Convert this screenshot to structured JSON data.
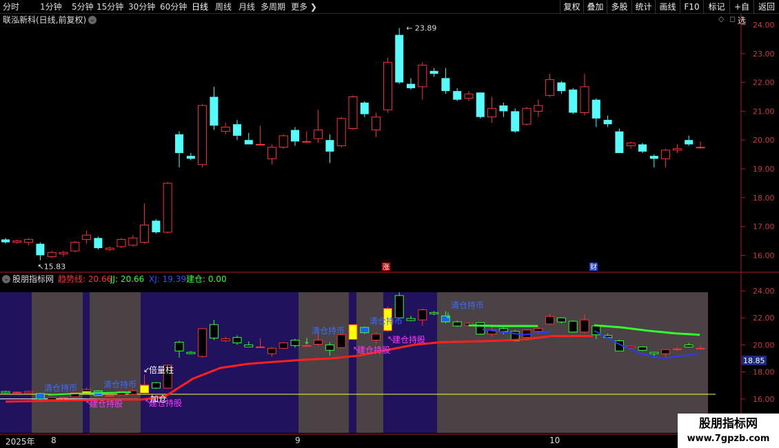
{
  "toolbar": {
    "periods": [
      "分时",
      "1分钟",
      "5分钟",
      "15分钟",
      "30分钟",
      "60分钟",
      "日线",
      "周线",
      "月线",
      "多周期",
      "更多"
    ],
    "active_period": "日线",
    "right_buttons": [
      "复权",
      "叠加",
      "多股",
      "统计",
      "画线",
      "F10",
      "标记",
      "+自选",
      "返回"
    ]
  },
  "chart": {
    "stock_title": "联泓新科(日线,前复权)",
    "high_label": "23.89",
    "low_label": "15.83",
    "zhang_mark": "涨",
    "cai_mark": "财",
    "price_axis": [
      "24.00",
      "23.00",
      "22.00",
      "21.00",
      "20.00",
      "19.00",
      "18.00",
      "17.00",
      "16.00"
    ],
    "colors": {
      "up": "#ff3232",
      "down": "#54fcfc",
      "axis": "#b01e1e",
      "bg": "#000000"
    },
    "candles": [
      [
        16.55,
        16.45,
        16.6,
        16.4
      ],
      [
        16.45,
        16.5,
        16.55,
        16.4
      ],
      [
        16.45,
        16.55,
        16.6,
        16.35
      ],
      [
        16.4,
        16.0,
        16.45,
        15.83
      ],
      [
        15.95,
        16.1,
        16.15,
        15.9
      ],
      [
        16.05,
        16.1,
        16.15,
        15.95
      ],
      [
        16.15,
        16.45,
        16.5,
        16.1
      ],
      [
        16.55,
        16.7,
        16.85,
        16.4
      ],
      [
        16.6,
        16.25,
        16.65,
        16.2
      ],
      [
        16.2,
        16.25,
        16.3,
        16.15
      ],
      [
        16.3,
        16.55,
        16.6,
        16.25
      ],
      [
        16.35,
        16.6,
        16.7,
        16.3
      ],
      [
        16.45,
        17.05,
        17.8,
        16.4
      ],
      [
        17.2,
        16.8,
        17.25,
        16.75
      ],
      [
        16.8,
        18.5,
        18.55,
        16.75
      ],
      [
        20.2,
        19.55,
        20.3,
        19.05
      ],
      [
        19.45,
        19.35,
        19.55,
        19.3
      ],
      [
        19.15,
        21.2,
        21.25,
        19.05
      ],
      [
        21.5,
        20.5,
        21.85,
        20.35
      ],
      [
        20.3,
        20.45,
        20.6,
        20.2
      ],
      [
        20.55,
        20.15,
        20.7,
        20.0
      ],
      [
        20.0,
        19.85,
        20.25,
        19.85
      ],
      [
        19.85,
        19.85,
        20.5,
        19.8
      ],
      [
        19.35,
        19.75,
        19.85,
        19.15
      ],
      [
        19.75,
        20.15,
        20.2,
        19.7
      ],
      [
        20.35,
        19.95,
        20.45,
        19.8
      ],
      [
        19.95,
        19.95,
        20.3,
        19.9
      ],
      [
        20.05,
        20.35,
        21.05,
        19.9
      ],
      [
        20.0,
        19.6,
        20.2,
        19.2
      ],
      [
        19.8,
        20.75,
        20.8,
        19.75
      ],
      [
        20.4,
        21.5,
        21.55,
        20.35
      ],
      [
        21.3,
        20.9,
        21.35,
        20.8
      ],
      [
        20.35,
        20.8,
        20.95,
        20.1
      ],
      [
        21.05,
        22.7,
        22.85,
        20.95
      ],
      [
        23.65,
        22.0,
        23.89,
        21.95
      ],
      [
        21.95,
        21.8,
        22.15,
        21.75
      ],
      [
        21.85,
        22.6,
        22.7,
        21.4
      ],
      [
        22.4,
        22.3,
        22.5,
        22.2
      ],
      [
        22.15,
        21.7,
        22.5,
        21.6
      ],
      [
        21.7,
        21.4,
        21.8,
        21.35
      ],
      [
        21.45,
        21.6,
        21.7,
        21.35
      ],
      [
        21.65,
        20.8,
        21.65,
        20.75
      ],
      [
        20.8,
        21.1,
        21.5,
        20.6
      ],
      [
        21.2,
        21.0,
        21.3,
        20.8
      ],
      [
        21.0,
        20.3,
        21.1,
        20.25
      ],
      [
        20.55,
        21.1,
        21.15,
        20.5
      ],
      [
        21.0,
        21.2,
        21.4,
        20.8
      ],
      [
        21.55,
        22.1,
        22.3,
        21.5
      ],
      [
        22.0,
        21.7,
        22.05,
        21.6
      ],
      [
        21.75,
        20.95,
        21.8,
        20.9
      ],
      [
        20.95,
        21.85,
        22.3,
        20.85
      ],
      [
        21.4,
        20.75,
        21.45,
        20.45
      ],
      [
        20.7,
        20.55,
        20.85,
        20.45
      ],
      [
        20.3,
        19.55,
        20.4,
        19.55
      ],
      [
        19.8,
        19.9,
        19.95,
        19.7
      ],
      [
        19.85,
        19.6,
        19.9,
        19.55
      ],
      [
        19.45,
        19.35,
        19.5,
        19.05
      ],
      [
        19.35,
        19.65,
        19.7,
        19.05
      ],
      [
        19.65,
        19.7,
        19.85,
        19.55
      ],
      [
        20.0,
        19.85,
        20.15,
        19.8
      ],
      [
        19.75,
        19.75,
        19.95,
        19.7
      ]
    ]
  },
  "indicator": {
    "panel_title": "股朋指标网",
    "trend_label": "趋势线: 20.66",
    "jj_label": "JJ: 20.66",
    "xj_label": "XJ: 19.39",
    "jc_label": "建仓: 0.00",
    "current_value": "18.85",
    "axis": [
      "24.00",
      "22.00",
      "20.00",
      "18.00",
      "16.00"
    ],
    "annotations": {
      "qingcang": "清仓持币",
      "jiancang": "建仓持股",
      "beiliang": "倍量柱",
      "jiacang": "加仓"
    }
  },
  "xaxis": {
    "year": "2025年",
    "months": [
      "8",
      "9",
      "10"
    ]
  },
  "watermark": {
    "title": "股朋指标网",
    "url": "www.7gpzb.com"
  }
}
